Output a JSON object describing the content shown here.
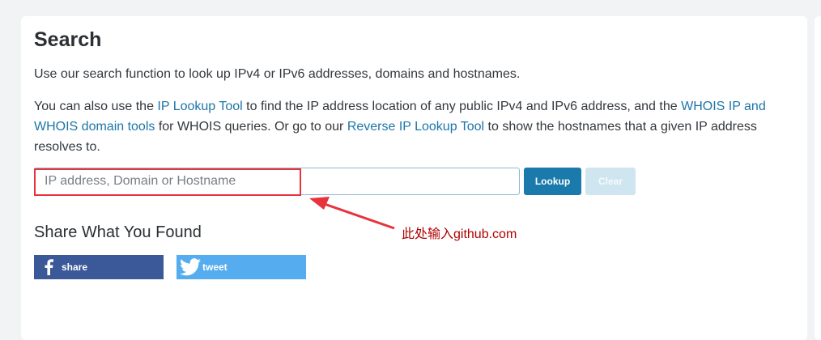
{
  "search": {
    "title": "Search",
    "intro": "Use our search function to look up IPv4 or IPv6 addresses, domains and hostnames.",
    "more": {
      "t1": "You can also use the ",
      "link1": "IP Lookup Tool",
      "t2": " to find the IP address location of any public IPv4 and IPv6 address, and the ",
      "link2": "WHOIS IP and WHOIS domain tools",
      "t3": " for WHOIS queries. Or go to our ",
      "link3": "Reverse IP Lookup Tool",
      "t4": " to show the hostnames that a given IP address resolves to."
    },
    "input_placeholder": "IP address, Domain or Hostname",
    "lookup_label": "Lookup",
    "clear_label": "Clear"
  },
  "annotation": {
    "note": "此处输入github.com",
    "color": "#e8323c"
  },
  "share": {
    "title": "Share What You Found",
    "facebook_label": "share",
    "twitter_label": "tweet",
    "facebook_color": "#3b5998",
    "twitter_color": "#55acee",
    "facebook_icon": "facebook-icon",
    "twitter_icon": "twitter-icon"
  }
}
